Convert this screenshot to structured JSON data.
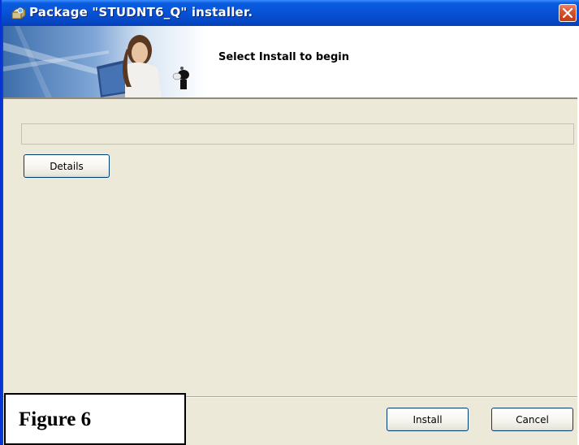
{
  "window": {
    "title": "Package \"STUDNT6_Q\" installer.",
    "title_icon": "installer-package-icon",
    "close_icon": "close-icon"
  },
  "banner": {
    "image": "woman-with-laptop-banner",
    "instruction": "Select Install to begin"
  },
  "progress": {
    "value": 0
  },
  "buttons": {
    "details": "Details",
    "install": "Install",
    "cancel": "Cancel"
  },
  "figure_caption": "Figure 6",
  "colors": {
    "titlebar": "#0a5ddf",
    "close_button": "#d9532f",
    "dialog_background": "#ece9d8",
    "button_border": "#003c74"
  }
}
